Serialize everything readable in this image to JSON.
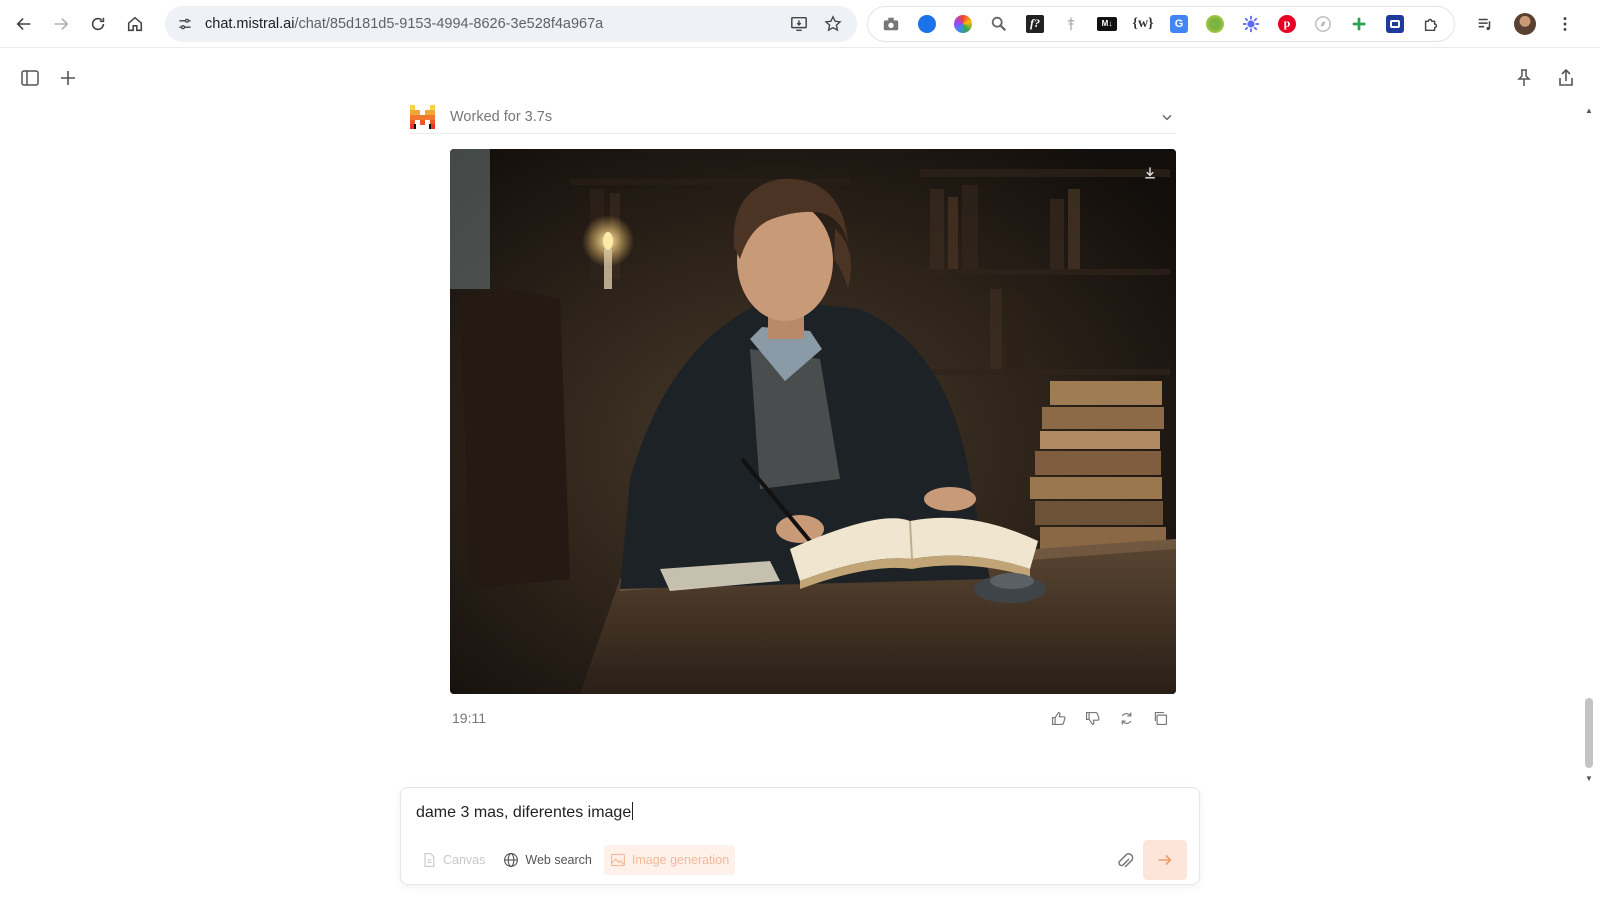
{
  "browser": {
    "url_host": "chat.mistral.ai",
    "url_path": "/chat/85d181d5-9153-4994-8626-3e528f4a967a",
    "extension_icons": [
      "camera-icon",
      "blue-circle-extension-icon",
      "color-wheel-extension-icon",
      "magnifier-extension-icon",
      "formula-extension-icon",
      "pin-extension-icon",
      "markdown-extension-icon",
      "wiki-extension-icon",
      "translate-extension-icon",
      "puzzle-green-extension-icon",
      "gear-blue-extension-icon",
      "pinterest-icon",
      "compass-extension-icon",
      "sparkle-plus-extension-icon",
      "screen-capture-extension-icon",
      "extensions-puzzle-icon"
    ],
    "colors": {
      "pinterest": "#e60023",
      "accent_blue": "#1a73e8"
    }
  },
  "conversation": {
    "worked_label": "Worked for 3.7s",
    "timestamp": "19:11",
    "image_alt": "Young man writing in a book at a desk in a dim library"
  },
  "composer": {
    "input_text": "dame 3 mas, diferentes image",
    "tools": {
      "canvas": "Canvas",
      "web_search": "Web search",
      "image_generation": "Image generation"
    }
  },
  "colors": {
    "send_bg": "#fde6d9",
    "send_fg": "#f09a66",
    "brand_orange": "#f28c28"
  }
}
